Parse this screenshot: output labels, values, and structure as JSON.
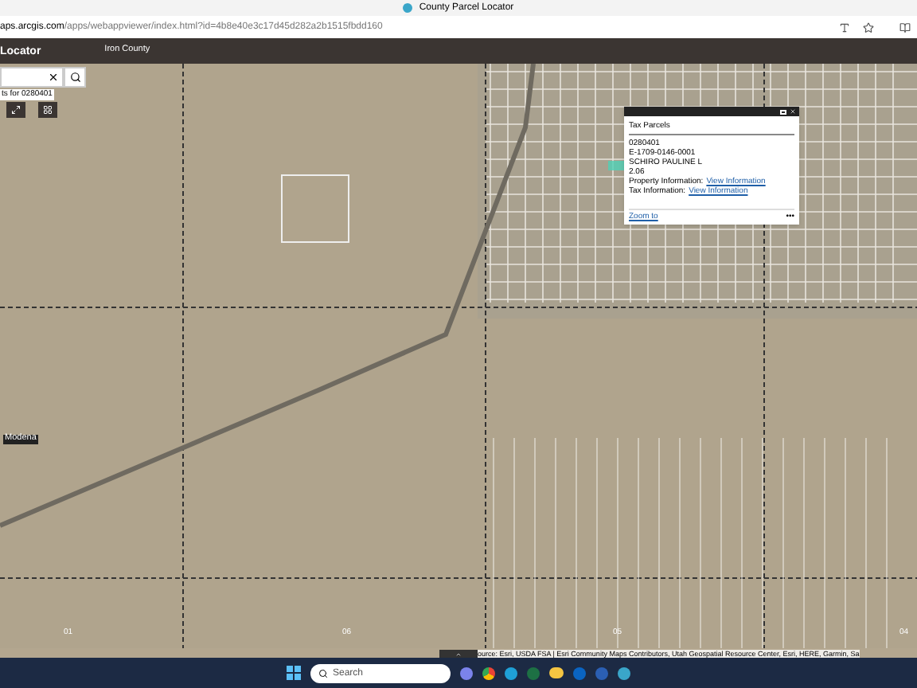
{
  "browser": {
    "tab_title": "County Parcel Locator",
    "url_host": "aps.arcgis.com",
    "url_path": "/apps/webappviewer/index.html?id=4b8e40e3c17d45d282a2b1515fbdd160"
  },
  "app_header": {
    "title": "Locator",
    "subtitle": "Iron County"
  },
  "search": {
    "results_hint": "ts for 0280401"
  },
  "map": {
    "place_label": "Modena",
    "section_labels": [
      "01",
      "06",
      "05",
      "04"
    ],
    "attribution": "ource: Esri, USDA FSA | Esri Community Maps Contributors, Utah Geospatial Resource Center, Esri, HERE, Garmin, Sa"
  },
  "popup": {
    "title": "Tax Parcels",
    "lines": [
      "0280401",
      "E-1709-0146-0001",
      "SCHIRO PAULINE L",
      "2.06"
    ],
    "links": [
      {
        "label": "Property Information:",
        "link": "View Information"
      },
      {
        "label": "Tax Information:",
        "link": "View Information"
      }
    ],
    "zoom_link": "Zoom to",
    "more": "•••"
  },
  "taskbar": {
    "search_placeholder": "Search"
  }
}
